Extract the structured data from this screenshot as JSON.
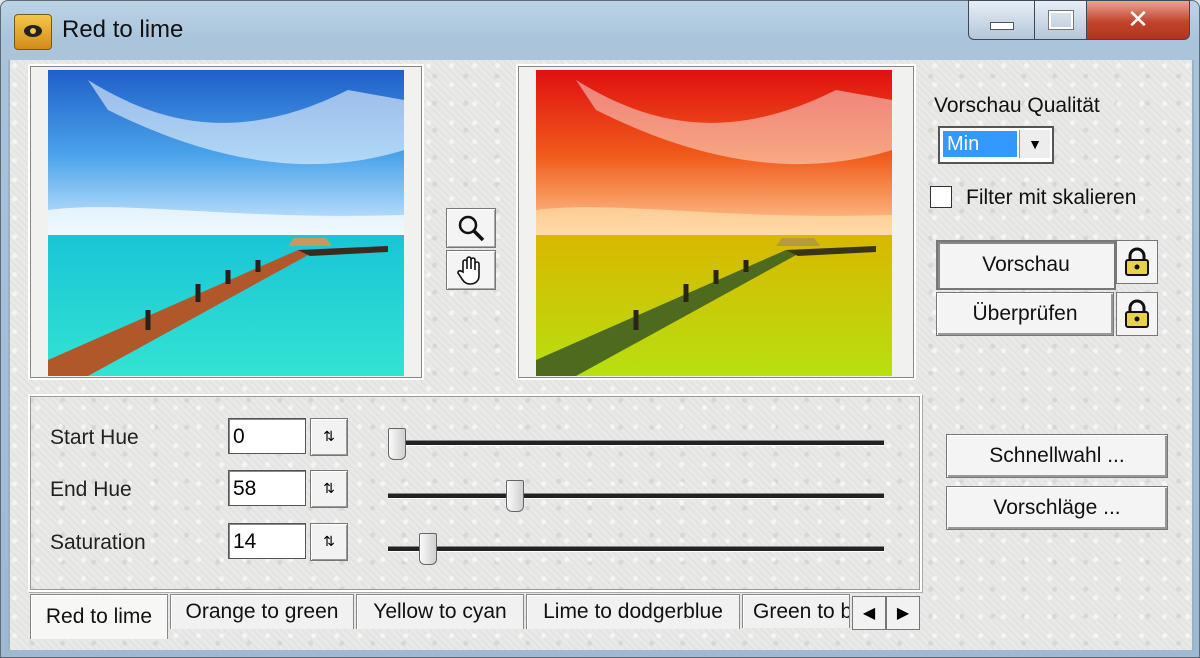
{
  "window": {
    "title": "Red to lime",
    "close_glyph": "✕"
  },
  "preview_tools": {
    "zoom_icon": "magnifier-icon",
    "pan_icon": "hand-icon"
  },
  "right_panel": {
    "quality_label": "Vorschau Qualität",
    "quality_value": "Min",
    "scale_label": "Filter mit skalieren",
    "scale_checked": false,
    "preview_button": "Vorschau",
    "check_button": "Überprüfen",
    "quick_select_button": "Schnellwahl ...",
    "suggestions_button": "Vorschläge ..."
  },
  "params": [
    {
      "label": "Start Hue",
      "value": "0",
      "fraction": 0.0
    },
    {
      "label": "End Hue",
      "value": "58",
      "fraction": 0.245
    },
    {
      "label": "Saturation",
      "value": "14",
      "fraction": 0.065
    }
  ],
  "tabs": [
    {
      "label": "Red to lime",
      "active": true
    },
    {
      "label": "Orange to green",
      "active": false
    },
    {
      "label": "Yellow to cyan",
      "active": false
    },
    {
      "label": "Lime to dodgerblue",
      "active": false
    },
    {
      "label": "Green to b",
      "active": false
    }
  ],
  "tab_scroll": {
    "left": "◀",
    "right": "▶"
  },
  "colors": {
    "selection": "#3399ff",
    "close": "#c2442c"
  }
}
